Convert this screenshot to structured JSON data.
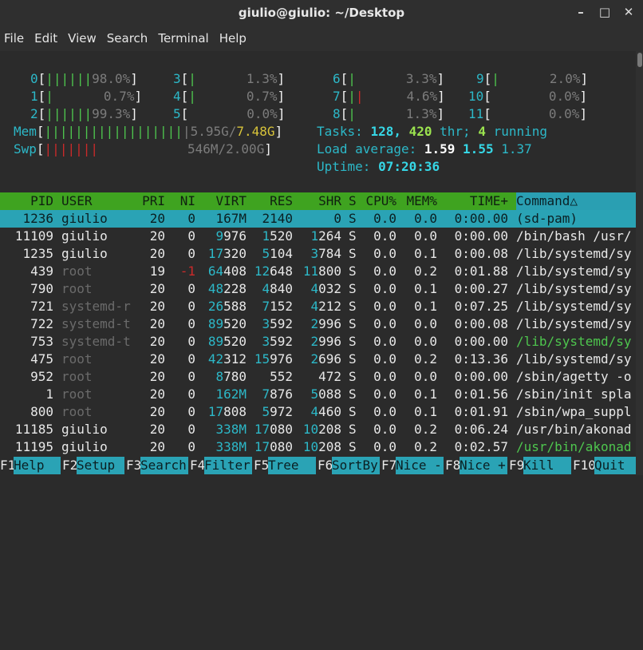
{
  "window": {
    "title": "giulio@giulio: ~/Desktop"
  },
  "menu": [
    "File",
    "Edit",
    "View",
    "Search",
    "Terminal",
    "Help"
  ],
  "cpus": [
    {
      "id": "0",
      "bar": "||||||",
      "pct": "98.0%"
    },
    {
      "id": "1",
      "bar": "|",
      "pct": "0.7%"
    },
    {
      "id": "2",
      "bar": "||||||",
      "pct": "99.3%"
    },
    {
      "id": "3",
      "bar": "|",
      "pct": "1.3%"
    },
    {
      "id": "4",
      "bar": "|",
      "pct": "0.7%"
    },
    {
      "id": "5",
      "bar": "",
      "pct": "0.0%"
    },
    {
      "id": "6",
      "bar": "|",
      "pct": "3.3%"
    },
    {
      "id": "7",
      "bar": "||",
      "pct": "4.6%"
    },
    {
      "id": "8",
      "bar": "|",
      "pct": "1.3%"
    },
    {
      "id": "9",
      "bar": "|",
      "pct": "2.0%"
    },
    {
      "id": "10",
      "bar": "",
      "pct": "0.0%"
    },
    {
      "id": "11",
      "bar": "",
      "pct": "0.0%"
    }
  ],
  "mem": {
    "label": "Mem",
    "bar": "||||||||||||||||||",
    "used": "5.95G",
    "total": "7.48G"
  },
  "swp": {
    "label": "Swp",
    "bar": "|||||||",
    "used": "546M",
    "total": "2.00G"
  },
  "tasks": {
    "label": "Tasks:",
    "count": "128,",
    "thr": "420",
    "thr_label": "thr;",
    "running": "4",
    "running_label": "running"
  },
  "load": {
    "label": "Load average:",
    "v1": "1.59",
    "v5": "1.55",
    "v15": "1.37"
  },
  "uptime": {
    "label": "Uptime:",
    "value": "07:20:36"
  },
  "columns": [
    "PID",
    "USER",
    "PRI",
    "NI",
    "VIRT",
    "RES",
    "SHR",
    "S",
    "CPU%",
    "MEM%",
    "TIME+",
    "Command△"
  ],
  "processes": [
    {
      "pid": "1236",
      "user": "giulio",
      "pri": "20",
      "ni": "0",
      "virt": "167M",
      "res": "2140",
      "shr": "0",
      "s": "S",
      "cpu": "0.0",
      "mem": "0.0",
      "time": "0:00.00",
      "cmd": "(sd-pam)"
    },
    {
      "pid": "11109",
      "user": "giulio",
      "pri": "20",
      "ni": "0",
      "virt": "9976",
      "res": "1520",
      "shr": "1264",
      "s": "S",
      "cpu": "0.0",
      "mem": "0.0",
      "time": "0:00.00",
      "cmd": "/bin/bash /usr/"
    },
    {
      "pid": "1235",
      "user": "giulio",
      "pri": "20",
      "ni": "0",
      "virt": "17320",
      "res": "5104",
      "shr": "3784",
      "s": "S",
      "cpu": "0.0",
      "mem": "0.1",
      "time": "0:00.08",
      "cmd": "/lib/systemd/sy"
    },
    {
      "pid": "439",
      "user": "root",
      "pri": "19",
      "ni": "-1",
      "virt": "64408",
      "res": "12648",
      "shr": "11800",
      "s": "S",
      "cpu": "0.0",
      "mem": "0.2",
      "time": "0:01.88",
      "cmd": "/lib/systemd/sy"
    },
    {
      "pid": "790",
      "user": "root",
      "pri": "20",
      "ni": "0",
      "virt": "48228",
      "res": "4840",
      "shr": "4032",
      "s": "S",
      "cpu": "0.0",
      "mem": "0.1",
      "time": "0:00.27",
      "cmd": "/lib/systemd/sy"
    },
    {
      "pid": "721",
      "user": "systemd-r",
      "pri": "20",
      "ni": "0",
      "virt": "26588",
      "res": "7152",
      "shr": "4212",
      "s": "S",
      "cpu": "0.0",
      "mem": "0.1",
      "time": "0:07.25",
      "cmd": "/lib/systemd/sy"
    },
    {
      "pid": "722",
      "user": "systemd-t",
      "pri": "20",
      "ni": "0",
      "virt": "89520",
      "res": "3592",
      "shr": "2996",
      "s": "S",
      "cpu": "0.0",
      "mem": "0.0",
      "time": "0:00.08",
      "cmd": "/lib/systemd/sy"
    },
    {
      "pid": "753",
      "user": "systemd-t",
      "pri": "20",
      "ni": "0",
      "virt": "89520",
      "res": "3592",
      "shr": "2996",
      "s": "S",
      "cpu": "0.0",
      "mem": "0.0",
      "time": "0:00.00",
      "cmd": "/lib/systemd/sy"
    },
    {
      "pid": "475",
      "user": "root",
      "pri": "20",
      "ni": "0",
      "virt": "42312",
      "res": "15976",
      "shr": "2696",
      "s": "S",
      "cpu": "0.0",
      "mem": "0.2",
      "time": "0:13.36",
      "cmd": "/lib/systemd/sy"
    },
    {
      "pid": "952",
      "user": "root",
      "pri": "20",
      "ni": "0",
      "virt": "8780",
      "res": "552",
      "shr": "472",
      "s": "S",
      "cpu": "0.0",
      "mem": "0.0",
      "time": "0:00.00",
      "cmd": "/sbin/agetty -o"
    },
    {
      "pid": "1",
      "user": "root",
      "pri": "20",
      "ni": "0",
      "virt": "162M",
      "res": "7876",
      "shr": "5088",
      "s": "S",
      "cpu": "0.0",
      "mem": "0.1",
      "time": "0:01.56",
      "cmd": "/sbin/init spla"
    },
    {
      "pid": "800",
      "user": "root",
      "pri": "20",
      "ni": "0",
      "virt": "17808",
      "res": "5972",
      "shr": "4460",
      "s": "S",
      "cpu": "0.0",
      "mem": "0.1",
      "time": "0:01.91",
      "cmd": "/sbin/wpa_suppl"
    },
    {
      "pid": "11185",
      "user": "giulio",
      "pri": "20",
      "ni": "0",
      "virt": "338M",
      "res": "17080",
      "shr": "10208",
      "s": "S",
      "cpu": "0.0",
      "mem": "0.2",
      "time": "0:06.24",
      "cmd": "/usr/bin/akonad"
    },
    {
      "pid": "11195",
      "user": "giulio",
      "pri": "20",
      "ni": "0",
      "virt": "338M",
      "res": "17080",
      "shr": "10208",
      "s": "S",
      "cpu": "0.0",
      "mem": "0.2",
      "time": "0:02.57",
      "cmd": "/usr/bin/akonad"
    }
  ],
  "fkeys": [
    {
      "key": "F1",
      "label": "Help"
    },
    {
      "key": "F2",
      "label": "Setup"
    },
    {
      "key": "F3",
      "label": "Search"
    },
    {
      "key": "F4",
      "label": "Filter"
    },
    {
      "key": "F5",
      "label": "Tree"
    },
    {
      "key": "F6",
      "label": "SortBy"
    },
    {
      "key": "F7",
      "label": "Nice -"
    },
    {
      "key": "F8",
      "label": "Nice +"
    },
    {
      "key": "F9",
      "label": "Kill"
    },
    {
      "key": "F10",
      "label": "Quit"
    }
  ],
  "colors": {
    "accent": "#2aa3b5",
    "header_bg": "#3fa320",
    "terminal_bg": "#2b2b2b"
  }
}
